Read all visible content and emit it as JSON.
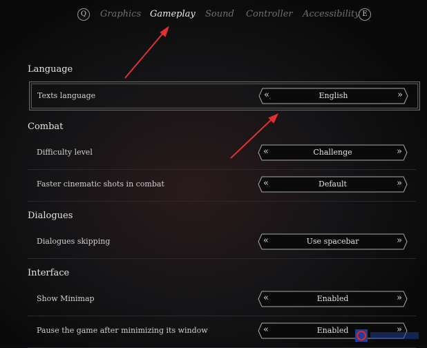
{
  "tabs": {
    "prev_key": "Q",
    "next_key": "E",
    "items": [
      {
        "label": "Graphics"
      },
      {
        "label": "Gameplay",
        "active": true
      },
      {
        "label": "Sound"
      },
      {
        "label": "Controller"
      },
      {
        "label": "Accessibility"
      }
    ]
  },
  "picker_prev": "«",
  "picker_next": "»",
  "sections": [
    {
      "title": "Language",
      "rows": [
        {
          "label": "Texts language",
          "value": "English",
          "selected": true
        }
      ]
    },
    {
      "title": "Combat",
      "rows": [
        {
          "label": "Difficulty level",
          "value": "Challenge"
        },
        {
          "label": "Faster cinematic shots in combat",
          "value": "Default"
        }
      ]
    },
    {
      "title": "Dialogues",
      "rows": [
        {
          "label": "Dialogues skipping",
          "value": "Use spacebar"
        }
      ]
    },
    {
      "title": "Interface",
      "rows": [
        {
          "label": "Show Minimap",
          "value": "Enabled"
        },
        {
          "label": "Pause the game after minimizing its window",
          "value": "Enabled"
        }
      ]
    }
  ],
  "colors": {
    "annotation_arrow": "#e03030",
    "background": "#0c0c0e"
  }
}
